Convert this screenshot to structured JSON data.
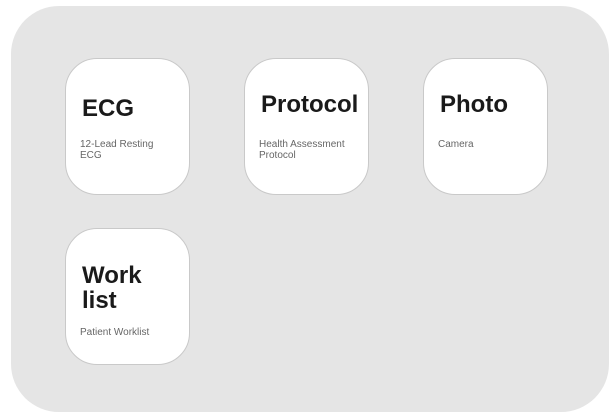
{
  "tiles": {
    "ecg": {
      "title": "ECG",
      "subtitle": "12-Lead Resting ECG"
    },
    "protocol": {
      "title": "Protocol",
      "subtitle": "Health Assessment Protocol"
    },
    "photo": {
      "title": "Photo",
      "subtitle": "Camera"
    },
    "worklist": {
      "title": "Work list",
      "subtitle": "Patient Worklist"
    }
  },
  "colors": {
    "panel_background": "#e5e5e5",
    "tile_background": "#ffffff",
    "title_text": "#1a1a1a",
    "subtitle_text": "#666666"
  }
}
